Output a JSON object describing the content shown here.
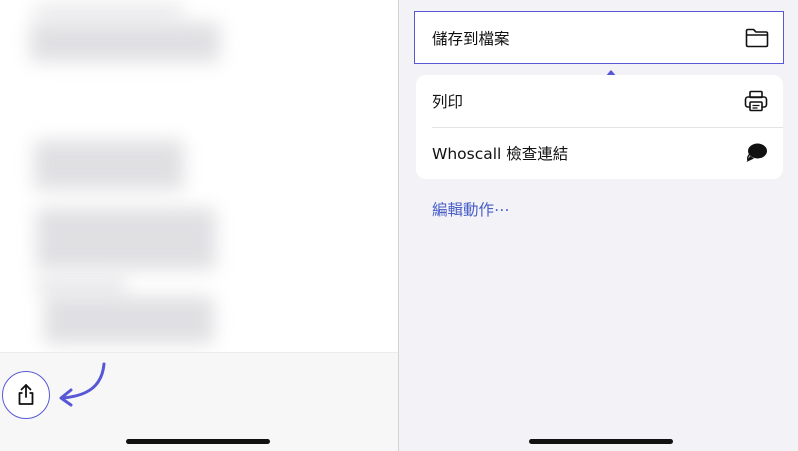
{
  "share_sheet": {
    "actions": [
      {
        "label": "儲存到檔案",
        "icon": "folder-icon",
        "highlighted": true
      },
      {
        "label": "列印",
        "icon": "printer-icon"
      },
      {
        "label": "Whoscall 檢查連結",
        "icon": "whoscall-icon"
      }
    ],
    "edit_actions_label": "編輯動作⋯"
  },
  "colors": {
    "highlight": "#5858d6",
    "link": "#4a5fc8",
    "sheet_background": "#f2f2f7"
  },
  "icons": {
    "share": "share-icon",
    "annotation_arrow": "curved-arrow-icon"
  }
}
